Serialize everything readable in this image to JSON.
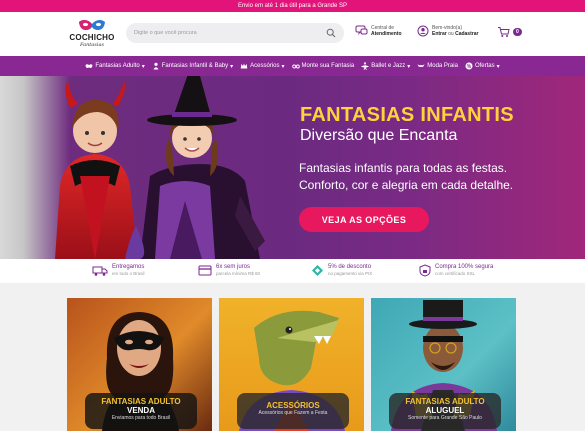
{
  "topbar": {
    "text": "Envio em até 1 dia útil para a Grande SP"
  },
  "logo": {
    "name": "COCHICHO",
    "sub": "Fantasias"
  },
  "search": {
    "placeholder": "Digite o que você procura"
  },
  "header": {
    "service_line1": "Central de",
    "service_line2": "Atendimento",
    "account_line1": "Bem-vindo(a)",
    "account_enter": "Entrar",
    "account_or": " ou ",
    "account_register": "Cadastrar",
    "cart_count": "0"
  },
  "nav": {
    "items": [
      {
        "label": "Fantasias Adulto",
        "icon": "mask-icon"
      },
      {
        "label": "Fantasias Infantil & Baby",
        "icon": "baby-icon"
      },
      {
        "label": "Acessórios",
        "icon": "crown-icon"
      },
      {
        "label": "Monte sua Fantasia",
        "icon": "glasses-icon"
      },
      {
        "label": "Ballet e Jazz",
        "icon": "ballet-icon"
      },
      {
        "label": "Moda Praia",
        "icon": "bikini-icon"
      },
      {
        "label": "Ofertas",
        "icon": "percent-icon"
      }
    ]
  },
  "hero": {
    "title": "FANTASIAS INFANTIS",
    "subtitle": "Diversão que Encanta",
    "desc_line1": "Fantasias infantis para todas as festas.",
    "desc_line2": "Conforto, cor e alegria em cada detalhe.",
    "button": "VEJA AS OPÇÕES"
  },
  "benefits": [
    {
      "title": "Entregamos",
      "sub": "em todo o Brasil",
      "icon": "truck-icon"
    },
    {
      "title": "6x sem juros",
      "sub": "parcela mínima R$ 60",
      "icon": "card-icon"
    },
    {
      "title": "5% de desconto",
      "sub": "no pagamento via PIX",
      "icon": "pix-icon"
    },
    {
      "title": "Compra 100% segura",
      "sub": "com certificado SSL",
      "icon": "lock-icon"
    }
  ],
  "cards": [
    {
      "title": "FANTASIAS ADULTO",
      "title2": "VENDA",
      "sub": "Enviamos para todo Brasil"
    },
    {
      "title": "ACESSÓRIOS",
      "title2": "",
      "sub": "Acessórios que Fazem a Festa"
    },
    {
      "title": "FANTASIAS ADULTO",
      "title2": "ALUGUEL",
      "sub": "Somente para Grande São Paulo"
    }
  ],
  "colors": {
    "accent": "#8a2893",
    "pink": "#e2147a",
    "yellow": "#ffd23a"
  }
}
